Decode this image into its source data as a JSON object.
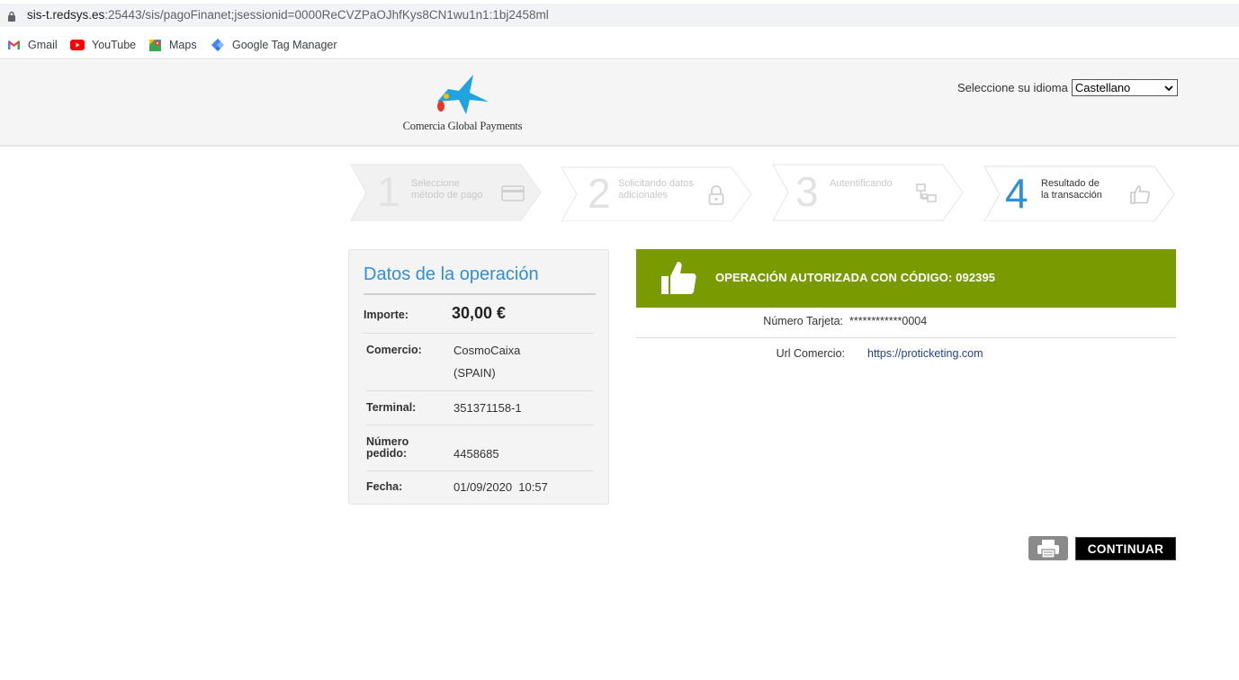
{
  "browser": {
    "url_host": "sis-t.redsys.es",
    "url_rest": ":25443/sis/pagoFinanet;jsessionid=0000ReCVZPaOJhfKys8CN1wu1n1:1bj2458ml",
    "bookmarks": [
      {
        "label": "Gmail",
        "icon": "gmail-icon"
      },
      {
        "label": "YouTube",
        "icon": "youtube-icon"
      },
      {
        "label": "Maps",
        "icon": "maps-icon"
      },
      {
        "label": "Google Tag Manager",
        "icon": "tag-manager-icon"
      }
    ]
  },
  "header": {
    "logo_text": "Comercia Global Payments",
    "language_label": "Seleccione su idioma",
    "language_selected": "Castellano"
  },
  "steps": [
    {
      "number": "1",
      "label": "Seleccione método de pago",
      "icon": "card-icon",
      "state": "inactive"
    },
    {
      "number": "2",
      "label": "Solicitando datos adicionales",
      "icon": "lock-icon",
      "state": "inactive"
    },
    {
      "number": "3",
      "label": "Autentificando",
      "icon": "network-icon",
      "state": "inactive"
    },
    {
      "number": "4",
      "label": "Resultado de la transacción",
      "icon": "thumbs-up-icon",
      "state": "active"
    }
  ],
  "operation": {
    "title": "Datos de la operación",
    "rows": [
      {
        "label": "Importe:",
        "value": "30,00 €"
      },
      {
        "label": "Comercio:",
        "value": "CosmoCaixa",
        "value2": "(SPAIN)"
      },
      {
        "label": "Terminal:",
        "value": "351371158-1"
      },
      {
        "label": "Número",
        "label2": "pedido:",
        "value": "4458685"
      },
      {
        "label": "Fecha:",
        "value": "01/09/2020  10:57"
      }
    ]
  },
  "result": {
    "message": "OPERACIÓN AUTORIZADA CON CÓDIGO: 092395",
    "card_label": "Número Tarjeta:",
    "card_value": "************0004",
    "url_label": "Url Comercio:",
    "url_value": "https://proticketing.com"
  },
  "actions": {
    "continue_label": "CONTINUAR"
  },
  "colors": {
    "accent_blue": "#2f8fd8",
    "success_green": "#7a9a01"
  }
}
